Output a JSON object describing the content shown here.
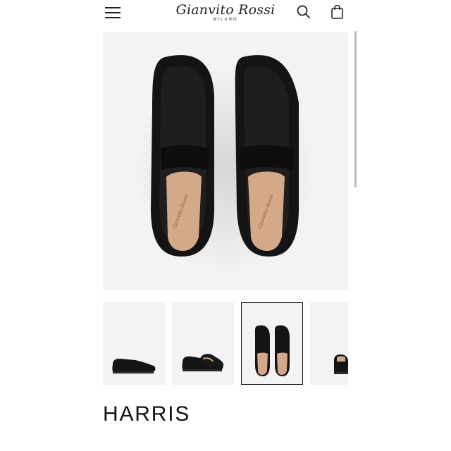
{
  "header": {
    "logo_main": "Gianvito Rossi",
    "logo_sub": "MILANO",
    "menu_icon": "hamburger-menu-icon",
    "search_icon": "search-icon",
    "bag_icon": "shopping-bag-icon"
  },
  "gallery": {
    "thumbnails": [
      {
        "view": "side-single"
      },
      {
        "view": "side-pair"
      },
      {
        "view": "top-pair",
        "active": true
      },
      {
        "view": "rear-partial"
      }
    ]
  },
  "product": {
    "name": "HARRIS",
    "insole_logo": "Gianvito Rossi"
  },
  "colors": {
    "image_bg": "#f4f2f2",
    "shoe": "#141414",
    "insole": "#d3a98a"
  }
}
